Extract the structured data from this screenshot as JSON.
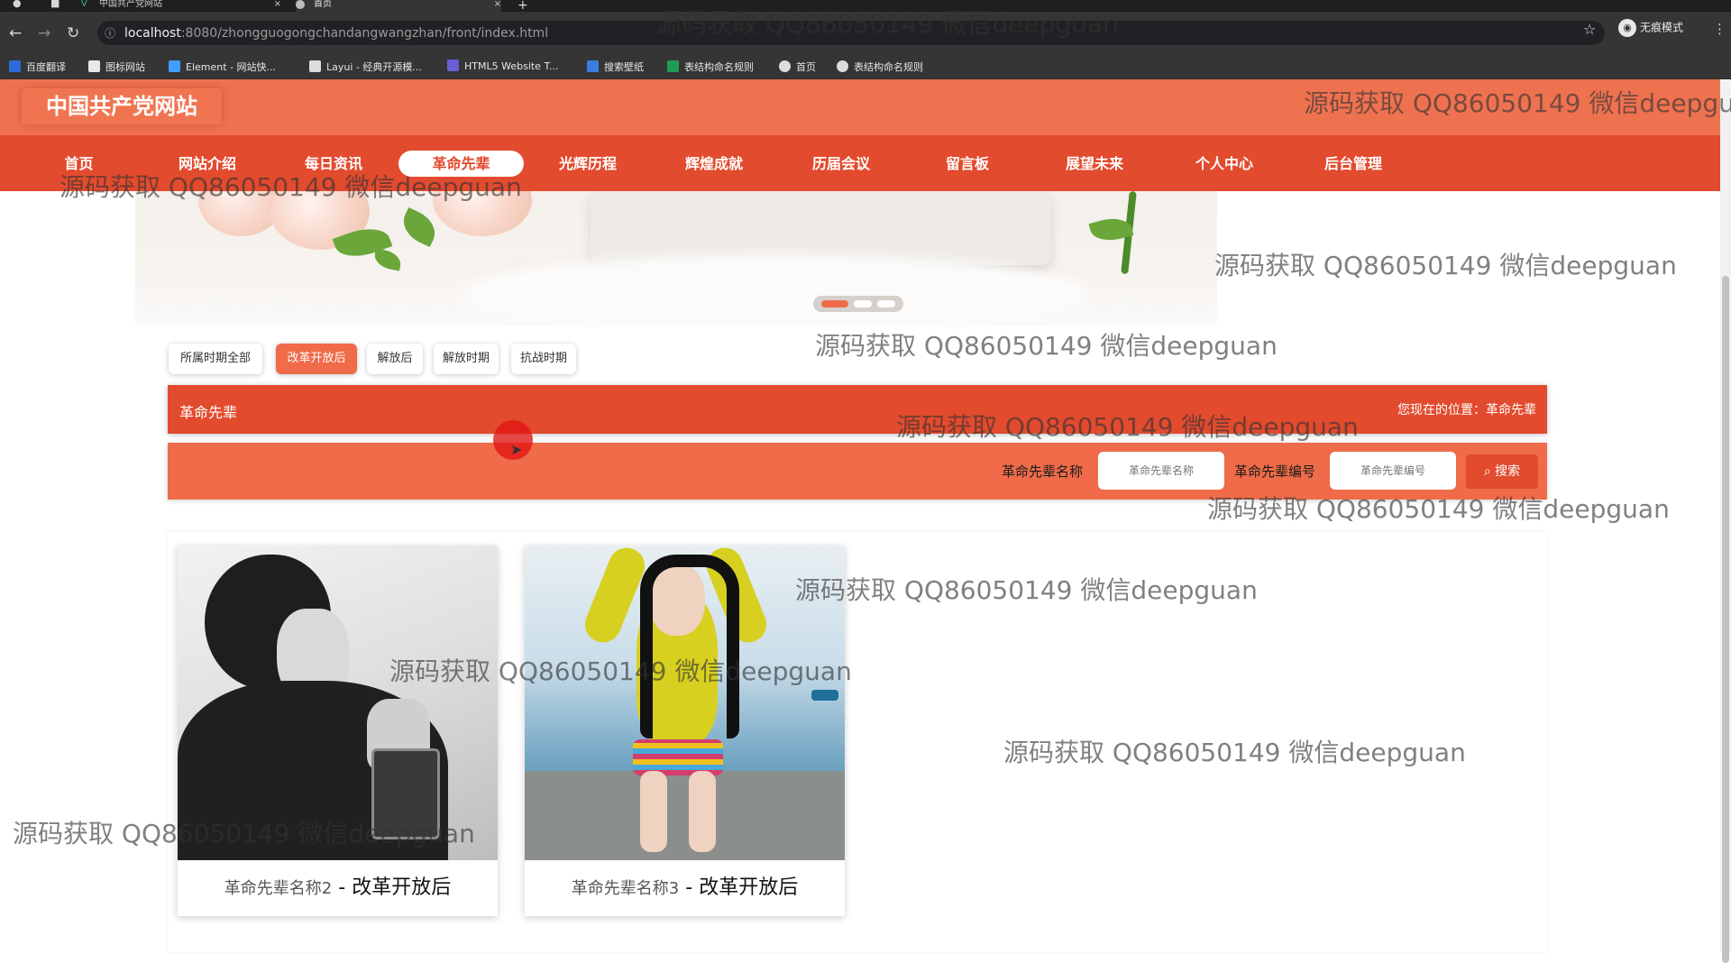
{
  "browser": {
    "tabs": [
      {
        "title": "中国共产党网站",
        "favicon": "vue-icon"
      },
      {
        "title": "首页",
        "favicon": "globe-icon",
        "active": true
      }
    ],
    "url": {
      "host": "localhost",
      "rest": ":8080/zhongguogongchandangwangzhan/front/index.html"
    },
    "profile_label": "无痕模式",
    "bookmarks": [
      {
        "label": "百度翻译",
        "color": "#2d6bd8"
      },
      {
        "label": "图标网站",
        "color": "#e8e8e8"
      },
      {
        "label": "Element - 网站快...",
        "color": "#409eff"
      },
      {
        "label": "Layui - 经典开源模...",
        "color": "#dddddd"
      },
      {
        "label": "HTML5 Website T...",
        "color": "#6b5fd6"
      },
      {
        "label": "搜索壁纸",
        "color": "#3d7de0"
      },
      {
        "label": "表结构命名规则",
        "color": "#1f9d55"
      },
      {
        "label": "首页",
        "color": "#dddddd"
      },
      {
        "label": "表结构命名规则",
        "color": "#dddddd"
      }
    ]
  },
  "site": {
    "logo": "中国共产党网站",
    "nav": [
      "首页",
      "网站介绍",
      "每日资讯",
      "革命先辈",
      "光辉历程",
      "辉煌成就",
      "历届会议",
      "留言板",
      "展望未来",
      "个人中心",
      "后台管理"
    ],
    "active_nav_index": 3,
    "accent": "#e24b2e",
    "header_color": "#ef7250"
  },
  "filters": [
    "所属时期全部",
    "改革开放后",
    "解放后",
    "解放时期",
    "抗战时期"
  ],
  "active_filter_index": 1,
  "section": {
    "title": "革命先辈",
    "location_prefix": "您现在的位置：",
    "location": "革命先辈"
  },
  "search": {
    "name_label": "革命先辈名称",
    "name_placeholder": "革命先辈名称",
    "code_label": "革命先辈编号",
    "code_placeholder": "革命先辈编号",
    "button": "搜索"
  },
  "cards": [
    {
      "name": "革命先辈名称2",
      "period": "改革开放后",
      "image": "portrait-bw"
    },
    {
      "name": "革命先辈名称3",
      "period": "改革开放后",
      "image": "seaside-photo"
    }
  ],
  "watermark": "源码获取 QQ86050149 微信deepguan"
}
